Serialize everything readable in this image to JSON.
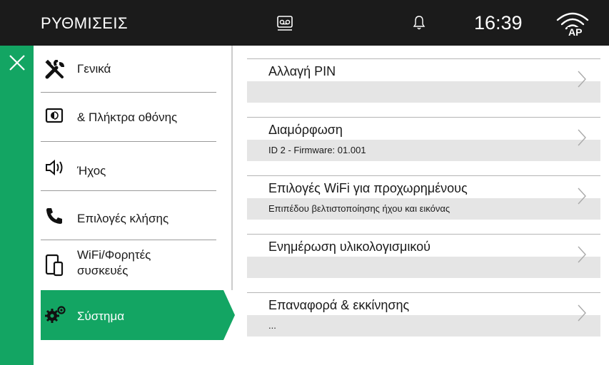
{
  "header": {
    "title": "ΡΥΘΜΙΣΕΙΣ",
    "time": "16:39",
    "wifi_badge": "AP",
    "icons": [
      "voicemail-icon",
      "bell-icon",
      "wifi-ap-icon"
    ]
  },
  "colors": {
    "header_bg": "#1b1b1b",
    "accent": "#13a563",
    "list_band": "#e5e5e5"
  },
  "menu": {
    "active_index": 5,
    "items": [
      {
        "label": "Γενικά",
        "icon": "wrench-screwdriver-icon"
      },
      {
        "label": "& Πλήκτρα οθόνης",
        "icon": "screen-keys-icon"
      },
      {
        "label": "Ήχος",
        "icon": "speaker-icon"
      },
      {
        "label": "Επιλογές κλήσης",
        "icon": "phone-icon"
      },
      {
        "label": "WiFi/Φορητές συσκευές",
        "label_line1": "WiFi/Φορητές",
        "label_line2": "συσκευές",
        "icon": "mobile-devices-icon"
      },
      {
        "label": "Σύστημα",
        "icon": "gears-icon"
      }
    ]
  },
  "settings": {
    "items": [
      {
        "title": "Αλλαγή PIN",
        "subtitle": ""
      },
      {
        "title": "Διαμόρφωση",
        "subtitle": "ID 2 - Firmware: 01.001"
      },
      {
        "title": "Επιλογές WiFi για προχωρημένους",
        "subtitle": "Επιπέδου βελτιστοποίησης ήχου και εικόνας"
      },
      {
        "title": "Ενημέρωση υλικολογισμικού",
        "subtitle": ""
      },
      {
        "title": "Επαναφορά & εκκίνησης",
        "subtitle": "..."
      }
    ]
  }
}
